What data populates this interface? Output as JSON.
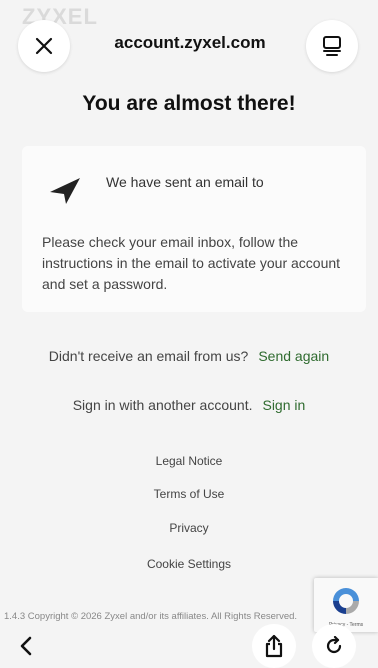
{
  "browser": {
    "logo_ghost": "ZYXEL",
    "url": "account.zyxel.com",
    "close_icon": "close-icon",
    "reader_icon": "reader-mode-icon",
    "back_icon": "chevron-left-icon",
    "share_icon": "share-icon",
    "reload_icon": "reload-icon"
  },
  "main": {
    "headline": "You are almost there!",
    "sent_text": "We have sent an email to",
    "instructions": "Please check your email inbox, follow the instructions in the email to activate your account and set a password.",
    "resend_prompt": "Didn't receive an email from us?",
    "resend_link": "Send again",
    "signin_prompt": "Sign in with another account.",
    "signin_link": "Sign in"
  },
  "footer": {
    "links": [
      "Legal Notice",
      "Terms of Use",
      "Privacy",
      "Cookie Settings"
    ],
    "copyright": "1.4.3 Copyright © 2026 Zyxel and/or its affiliates. All Rights Reserved."
  },
  "recaptcha": {
    "links": "Privacy - Terms"
  },
  "colors": {
    "link_green": "#2f6b2f",
    "background": "#f4f4f4"
  }
}
